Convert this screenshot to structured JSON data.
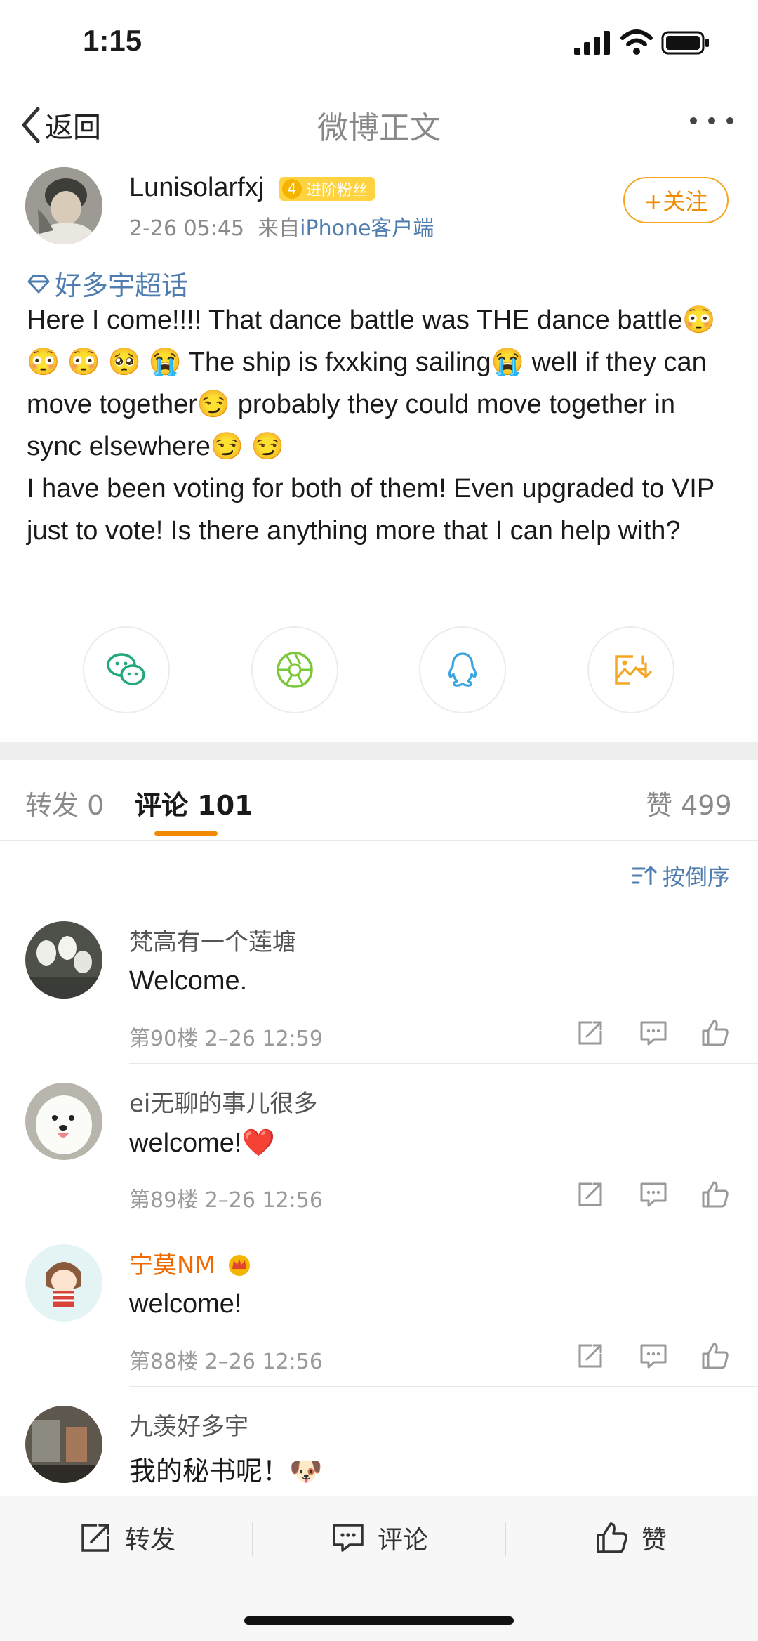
{
  "status_bar": {
    "time": "1:15"
  },
  "nav": {
    "back_label": "返回",
    "title": "微博正文"
  },
  "post": {
    "author": "Lunisolarfxj",
    "fan_badge": {
      "level": "4",
      "label": "进阶粉丝"
    },
    "date": "2-26 05:45",
    "source_prefix": "来自",
    "source": "iPhone客户端",
    "follow_label": "+关注",
    "topic": "好多宇超话",
    "body_lines": [
      "Here I come!!!! That dance battle was THE dance battle😳 😳 😳 🥺 😭 The ship is fxxking sailing😭 well if they can move together😏 probably they could move together in sync elsewhere😏 😏",
      "I have been voting for both of them! Even upgraded to VIP just to vote! Is there anything more that I can help with?"
    ]
  },
  "tabs": {
    "repost": {
      "label": "转发",
      "count": "0"
    },
    "comment": {
      "label": "评论",
      "count": "101"
    },
    "like": {
      "label": "赞",
      "count": "499"
    }
  },
  "sort_label": "按倒序",
  "comments": [
    {
      "name": "梵高有一个莲塘",
      "text": "Welcome.",
      "meta": "第90楼 2–26 12:59"
    },
    {
      "name": "ei无聊的事儿很多",
      "text": "welcome!❤️",
      "meta": "第89楼 2–26 12:56"
    },
    {
      "name": "宁莫NM",
      "text": "welcome!",
      "meta": "第88楼 2–26 12:56"
    },
    {
      "name": "九羡好多宇",
      "text": "我的秘书呢！🐶"
    }
  ],
  "bottom_bar": {
    "repost": "转发",
    "comment": "评论",
    "like": "赞"
  },
  "colors": {
    "accent_orange": "#f08a00",
    "link_blue": "#507daf",
    "vip_name": "#f06a00"
  }
}
